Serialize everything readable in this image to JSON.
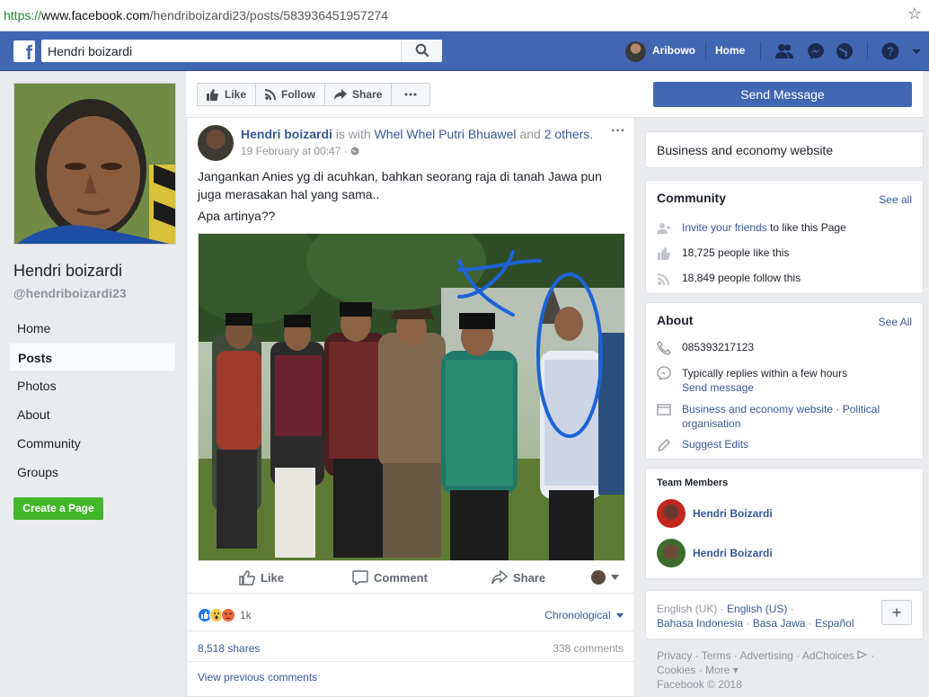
{
  "browser": {
    "url_scheme": "https://",
    "url_host": "www.facebook.com",
    "url_path": "/hendriboizardi23/posts/583936451957274"
  },
  "topbar": {
    "search_value": "Hendri boizardi",
    "user_name": "Aribowo",
    "home_label": "Home"
  },
  "left": {
    "page_name": "Hendri boizardi",
    "handle": "@hendriboizardi23",
    "nav": [
      "Home",
      "Posts",
      "Photos",
      "About",
      "Community",
      "Groups"
    ],
    "active_nav": "Posts",
    "create_page": "Create a Page"
  },
  "actionbar": {
    "like": "Like",
    "follow": "Follow",
    "share": "Share",
    "send_message": "Send Message"
  },
  "post": {
    "author": "Hendri boizardi",
    "is_with": "is with",
    "with_person": "Whel Whel Putri Bhuawel",
    "and": "and",
    "others": "2 others.",
    "date": "19 February at 00:47 ·",
    "text1": "Jangankan Anies yg di acuhkan, bahkan seorang raja di tanah Jawa pun juga merasakan hal yang sama..",
    "text2": "Apa artinya??",
    "like": "Like",
    "comment": "Comment",
    "share": "Share",
    "reaction_count": "1k",
    "order": "Chronological",
    "shares": "8,518 shares",
    "comments": "338 comments",
    "view_previous": "View previous comments"
  },
  "right": {
    "category": "Business and economy website",
    "community": {
      "title": "Community",
      "see_all": "See all",
      "invite_link": "Invite your friends",
      "invite_rest": " to like this Page",
      "likes": "18,725 people like this",
      "follows": "18,849 people follow this"
    },
    "about": {
      "title": "About",
      "see_all": "See All",
      "phone": "085393217123",
      "replies": "Typically replies within a few hours",
      "send_message": "Send message",
      "categories": "Business and economy website · Political organisation",
      "suggest": "Suggest Edits"
    },
    "team": {
      "title": "Team Members",
      "members": [
        "Hendri Boizardi",
        "Hendri Boizardi"
      ]
    },
    "languages": {
      "line1_a": "English (UK)",
      "line1_b": " · ",
      "line1_c": "English (US)",
      "line1_d": " ·",
      "line2_a": "Bahasa Indonesia",
      "line2_b": " · ",
      "line2_c": "Basa Jawa",
      "line2_d": " · ",
      "line2_e": "Español",
      "plus": "+"
    },
    "footer": {
      "line1": "Privacy · Terms · Advertising · AdChoices",
      "line2": "Cookies · More ▾",
      "line3": "Facebook © 2018"
    }
  },
  "colors": {
    "brand": "#4267b2",
    "link": "#365899",
    "green": "#42b72a"
  }
}
